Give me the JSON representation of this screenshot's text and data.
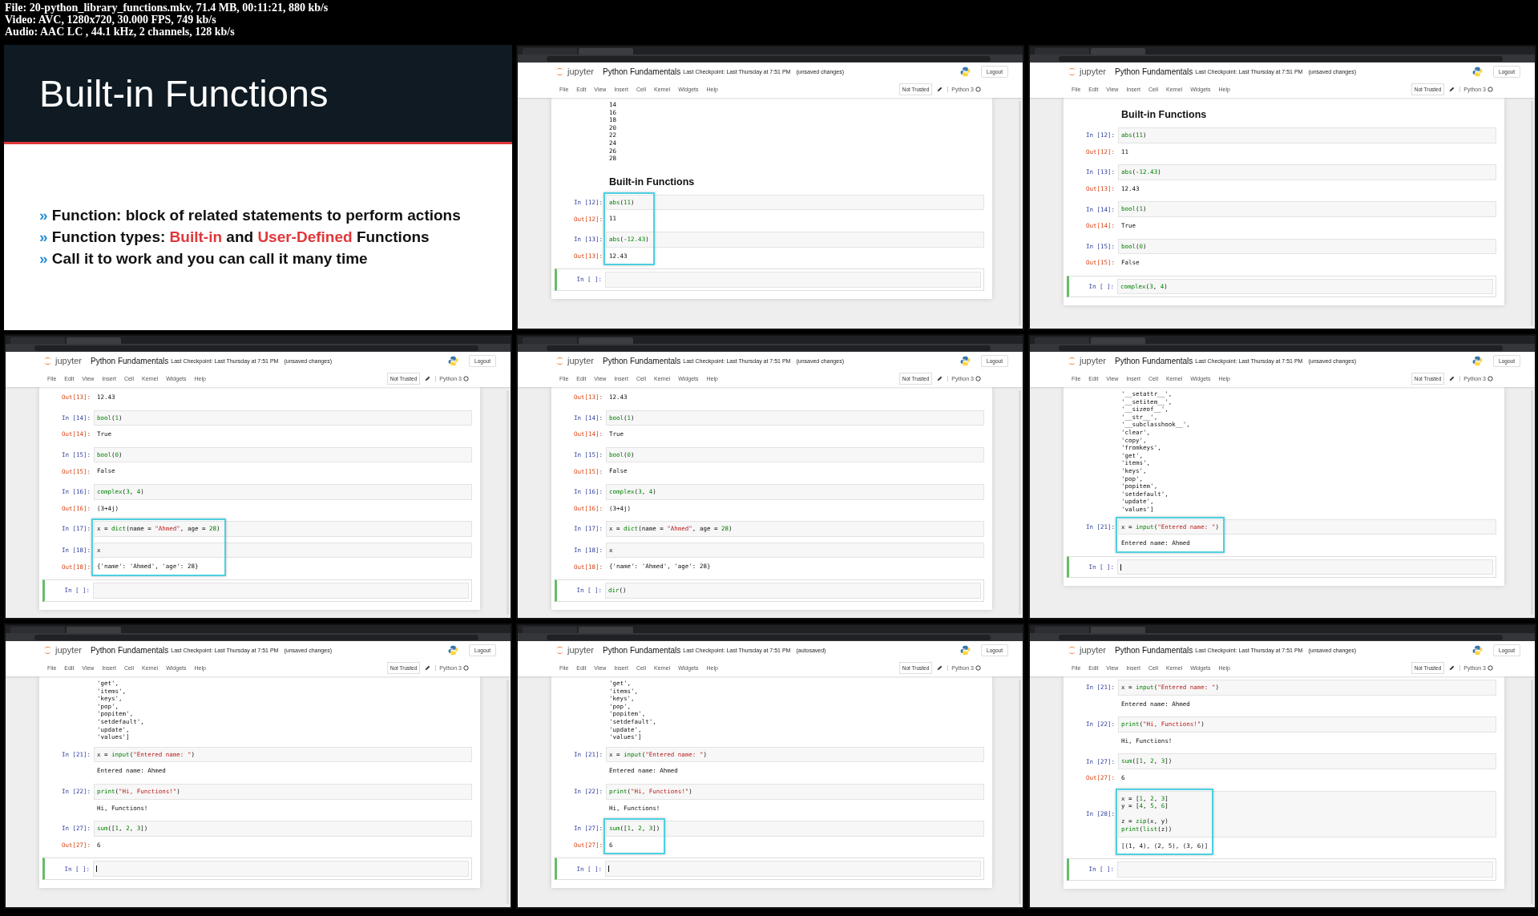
{
  "file_info": [
    "File: 20-python_library_functions.mkv, 71.4 MB, 00:11:21, 880 kb/s",
    "Video: AVC, 1280x720, 30.000 FPS, 749 kb/s",
    "Audio: AAC LC , 44.1 kHz, 2 channels, 128 kb/s"
  ],
  "frames": [
    {
      "kind": "slide",
      "title": "Built-in Functions",
      "bullets": [
        {
          "marker": "»",
          "segments": [
            {
              "text": "Function: block of related statements to perform actions",
              "emphasis": false
            }
          ]
        },
        {
          "marker": "»",
          "segments": [
            {
              "text": "Function types: ",
              "emphasis": false
            },
            {
              "text": "Built-in",
              "emphasis": true
            },
            {
              "text": " and ",
              "emphasis": false
            },
            {
              "text": "User-Defined",
              "emphasis": true
            },
            {
              "text": " Functions",
              "emphasis": false
            }
          ]
        },
        {
          "marker": "»",
          "segments": [
            {
              "text": "Call it to work and you can call it many time",
              "emphasis": false
            }
          ]
        }
      ]
    },
    {
      "kind": "notebook",
      "logo": "jupyter",
      "notebook_title": "Python Fundamentals",
      "checkpoint": "Last Checkpoint: Last Thursday at 7:51 PM",
      "save_status": "(unsaved changes)",
      "logout": "Logout",
      "menu": [
        "File",
        "Edit",
        "View",
        "Insert",
        "Cell",
        "Kernel",
        "Widgets",
        "Help"
      ],
      "trust": "Not Trusted",
      "kernel": "Python 3",
      "cells": [
        {
          "kind": "tail",
          "text": "14\n16\n18\n20\n22\n24\n26\n28"
        },
        {
          "kind": "heading",
          "text": "Built-in Functions"
        },
        {
          "kind": "code",
          "prompt": "In [12]:",
          "code": "abs(11)",
          "out_prompt": "Out[12]:",
          "output": "11",
          "highlighted": true
        },
        {
          "kind": "code",
          "prompt": "In [13]:",
          "code": "abs(-12.43)",
          "out_prompt": "Out[13]:",
          "output": "12.43",
          "highlighted": true
        },
        {
          "kind": "current",
          "prompt": "In [ ]:",
          "cursor": false
        }
      ]
    },
    {
      "kind": "notebook",
      "logo": "jupyter",
      "notebook_title": "Python Fundamentals",
      "checkpoint": "Last Checkpoint: Last Thursday at 7:51 PM",
      "save_status": "(unsaved changes)",
      "logout": "Logout",
      "menu": [
        "File",
        "Edit",
        "View",
        "Insert",
        "Cell",
        "Kernel",
        "Widgets",
        "Help"
      ],
      "trust": "Not Trusted",
      "kernel": "Python 3",
      "cells": [
        {
          "kind": "heading",
          "text": "Built-in Functions"
        },
        {
          "kind": "code",
          "prompt": "In [12]:",
          "code": "abs(11)",
          "out_prompt": "Out[12]:",
          "output": "11",
          "highlighted": false
        },
        {
          "kind": "code",
          "prompt": "In [13]:",
          "code": "abs(-12.43)",
          "out_prompt": "Out[13]:",
          "output": "12.43",
          "highlighted": false
        },
        {
          "kind": "code",
          "prompt": "In [14]:",
          "code": "bool(1)",
          "out_prompt": "Out[14]:",
          "output": "True",
          "highlighted": false
        },
        {
          "kind": "code",
          "prompt": "In [15]:",
          "code": "bool(0)",
          "out_prompt": "Out[15]:",
          "output": "False",
          "highlighted": false
        },
        {
          "kind": "current",
          "prompt": "In [ ]:",
          "code": "complex(3, 4)",
          "cursor": false
        }
      ]
    },
    {
      "kind": "notebook",
      "logo": "jupyter",
      "notebook_title": "Python Fundamentals",
      "checkpoint": "Last Checkpoint: Last Thursday at 7:51 PM",
      "save_status": "(unsaved changes)",
      "logout": "Logout",
      "menu": [
        "File",
        "Edit",
        "View",
        "Insert",
        "Cell",
        "Kernel",
        "Widgets",
        "Help"
      ],
      "trust": "Not Trusted",
      "kernel": "Python 3",
      "cells": [
        {
          "kind": "code",
          "out_prompt": "Out[13]:",
          "output": "12.43",
          "highlighted": false
        },
        {
          "kind": "code",
          "prompt": "In [14]:",
          "code": "bool(1)",
          "out_prompt": "Out[14]:",
          "output": "True",
          "highlighted": false
        },
        {
          "kind": "code",
          "prompt": "In [15]:",
          "code": "bool(0)",
          "out_prompt": "Out[15]:",
          "output": "False",
          "highlighted": false
        },
        {
          "kind": "code",
          "prompt": "In [16]:",
          "code": "complex(3, 4)",
          "out_prompt": "Out[16]:",
          "output": "(3+4j)",
          "highlighted": false
        },
        {
          "kind": "code",
          "prompt": "In [17]:",
          "code": "x = dict(name = \"Ahmed\", age = 28)",
          "highlighted": true
        },
        {
          "kind": "code",
          "prompt": "In [18]:",
          "code": "x",
          "out_prompt": "Out[18]:",
          "output": "{'name': 'Ahmed', 'age': 28}",
          "highlighted": true
        },
        {
          "kind": "current",
          "prompt": "In [ ]:",
          "cursor": false
        }
      ]
    },
    {
      "kind": "notebook",
      "logo": "jupyter",
      "notebook_title": "Python Fundamentals",
      "checkpoint": "Last Checkpoint: Last Thursday at 7:51 PM",
      "save_status": "(unsaved changes)",
      "logout": "Logout",
      "menu": [
        "File",
        "Edit",
        "View",
        "Insert",
        "Cell",
        "Kernel",
        "Widgets",
        "Help"
      ],
      "trust": "Not Trusted",
      "kernel": "Python 3",
      "cells": [
        {
          "kind": "code",
          "out_prompt": "Out[13]:",
          "output": "12.43",
          "highlighted": false
        },
        {
          "kind": "code",
          "prompt": "In [14]:",
          "code": "bool(1)",
          "out_prompt": "Out[14]:",
          "output": "True",
          "highlighted": false
        },
        {
          "kind": "code",
          "prompt": "In [15]:",
          "code": "bool(0)",
          "out_prompt": "Out[15]:",
          "output": "False",
          "highlighted": false
        },
        {
          "kind": "code",
          "prompt": "In [16]:",
          "code": "complex(3, 4)",
          "out_prompt": "Out[16]:",
          "output": "(3+4j)",
          "highlighted": false
        },
        {
          "kind": "code",
          "prompt": "In [17]:",
          "code": "x = dict(name = \"Ahmed\", age = 28)",
          "highlighted": false
        },
        {
          "kind": "code",
          "prompt": "In [18]:",
          "code": "x",
          "out_prompt": "Out[18]:",
          "output": "{'name': 'Ahmed', 'age': 28}",
          "highlighted": false
        },
        {
          "kind": "current",
          "prompt": "In [ ]:",
          "code": "dir()",
          "cursor": false
        }
      ]
    },
    {
      "kind": "notebook",
      "logo": "jupyter",
      "notebook_title": "Python Fundamentals",
      "checkpoint": "Last Checkpoint: Last Thursday at 7:51 PM",
      "save_status": "(unsaved changes)",
      "logout": "Logout",
      "menu": [
        "File",
        "Edit",
        "View",
        "Insert",
        "Cell",
        "Kernel",
        "Widgets",
        "Help"
      ],
      "trust": "Not Trusted",
      "kernel": "Python 3",
      "cells": [
        {
          "kind": "tail",
          "text": "'__setattr__',\n'__setitem__',\n'__sizeof__',\n'__str__',\n'__subclasshook__',\n'clear',\n'copy',\n'fromkeys',\n'get',\n'items',\n'keys',\n'pop',\n'popitem',\n'setdefault',\n'update',\n'values']"
        },
        {
          "kind": "code",
          "prompt": "In [21]:",
          "code": "x = input(\"Entered name: \")",
          "output": "Entered name: Ahmed",
          "highlighted": true
        },
        {
          "kind": "current",
          "prompt": "In [ ]:",
          "cursor": true
        }
      ]
    },
    {
      "kind": "notebook",
      "logo": "jupyter",
      "notebook_title": "Python Fundamentals",
      "checkpoint": "Last Checkpoint: Last Thursday at 7:51 PM",
      "save_status": "(unsaved changes)",
      "logout": "Logout",
      "menu": [
        "File",
        "Edit",
        "View",
        "Insert",
        "Cell",
        "Kernel",
        "Widgets",
        "Help"
      ],
      "trust": "Not Trusted",
      "kernel": "Python 3",
      "cells": [
        {
          "kind": "tail",
          "text": "'get',\n'items',\n'keys',\n'pop',\n'popitem',\n'setdefault',\n'update',\n'values']"
        },
        {
          "kind": "code",
          "prompt": "In [21]:",
          "code": "x = input(\"Entered name: \")",
          "output": "Entered name: Ahmed",
          "highlighted": false
        },
        {
          "kind": "code",
          "prompt": "In [22]:",
          "code": "print(\"Hi, Functions!\")",
          "output": "Hi, Functions!",
          "highlighted": false
        },
        {
          "kind": "code",
          "prompt": "In [27]:",
          "code": "sum([1, 2, 3])",
          "out_prompt": "Out[27]:",
          "output": "6",
          "highlighted": false
        },
        {
          "kind": "current",
          "prompt": "In [ ]:",
          "cursor": true
        }
      ]
    },
    {
      "kind": "notebook",
      "logo": "jupyter",
      "notebook_title": "Python Fundamentals",
      "checkpoint": "Last Checkpoint: Last Thursday at 7:51 PM",
      "save_status": "(autosaved)",
      "logout": "Logout",
      "menu": [
        "File",
        "Edit",
        "View",
        "Insert",
        "Cell",
        "Kernel",
        "Widgets",
        "Help"
      ],
      "trust": "Not Trusted",
      "kernel": "Python 3",
      "cells": [
        {
          "kind": "tail",
          "text": "'get',\n'items',\n'keys',\n'pop',\n'popitem',\n'setdefault',\n'update',\n'values']"
        },
        {
          "kind": "code",
          "prompt": "In [21]:",
          "code": "x = input(\"Entered name: \")",
          "output": "Entered name: Ahmed",
          "highlighted": false
        },
        {
          "kind": "code",
          "prompt": "In [22]:",
          "code": "print(\"Hi, Functions!\")",
          "output": "Hi, Functions!",
          "highlighted": false
        },
        {
          "kind": "code",
          "prompt": "In [27]:",
          "code": "sum([1, 2, 3])",
          "out_prompt": "Out[27]:",
          "output": "6",
          "highlighted": true
        },
        {
          "kind": "current",
          "prompt": "In [ ]:",
          "cursor": true
        }
      ]
    },
    {
      "kind": "notebook",
      "logo": "jupyter",
      "notebook_title": "Python Fundamentals",
      "checkpoint": "Last Checkpoint: Last Thursday at 7:51 PM",
      "save_status": "(unsaved changes)",
      "logout": "Logout",
      "menu": [
        "File",
        "Edit",
        "View",
        "Insert",
        "Cell",
        "Kernel",
        "Widgets",
        "Help"
      ],
      "trust": "Not Trusted",
      "kernel": "Python 3",
      "cells": [
        {
          "kind": "code",
          "prompt": "In [21]:",
          "code": "x = input(\"Entered name: \")",
          "output": "Entered name: Ahmed",
          "highlighted": false
        },
        {
          "kind": "code",
          "prompt": "In [22]:",
          "code": "print(\"Hi, Functions!\")",
          "output": "Hi, Functions!",
          "highlighted": false
        },
        {
          "kind": "code",
          "prompt": "In [27]:",
          "code": "sum([1, 2, 3])",
          "out_prompt": "Out[27]:",
          "output": "6",
          "highlighted": false
        },
        {
          "kind": "code",
          "prompt": "In [28]:",
          "code": "x = [1, 2, 3]\ny = [4, 5, 6]\n\nz = zip(x, y)\nprint(list(z))",
          "output": "[(1, 4), (2, 5), (3, 6)]",
          "highlighted": true
        },
        {
          "kind": "current",
          "prompt": "In [ ]:",
          "cursor": false
        }
      ]
    }
  ]
}
